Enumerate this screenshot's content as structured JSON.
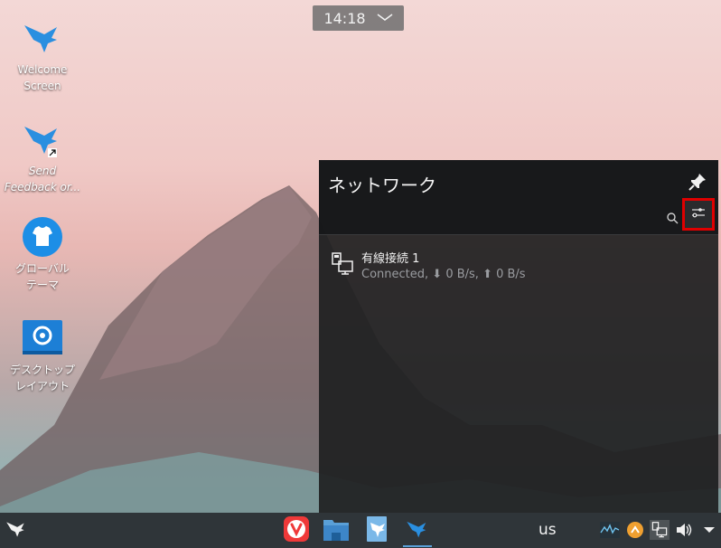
{
  "clock": {
    "time": "14:18",
    "expand_icon": "chevron-down-icon"
  },
  "desktop": {
    "icons": [
      {
        "label_line1": "Welcome",
        "label_line2": "Screen",
        "icon": "bird-logo-icon"
      },
      {
        "label_line1": "Send",
        "label_line2": "Feedback or...",
        "icon": "bird-logo-link-icon"
      },
      {
        "label_line1": "グローバル",
        "label_line2": "テーマ",
        "icon": "shirt-icon"
      },
      {
        "label_line1": "デスクトップ",
        "label_line2": "レイアウト",
        "icon": "desktop-layout-icon"
      }
    ]
  },
  "network_panel": {
    "title": "ネットワーク",
    "pin_icon": "pin-icon",
    "search_icon": "search-icon",
    "settings_icon": "settings-sliders-icon",
    "connection": {
      "name": "有線接続 1",
      "status_prefix": "Connected, ",
      "down": "0 B/s",
      "separator": ", ",
      "up": "0 B/s",
      "icon": "wired-network-icon"
    }
  },
  "taskbar": {
    "launcher_icon": "bird-logo-icon",
    "apps": [
      {
        "name": "vivaldi-icon"
      },
      {
        "name": "file-manager-icon"
      },
      {
        "name": "document-viewer-icon"
      },
      {
        "name": "bird-app-icon"
      }
    ],
    "keyboard_layout": "us",
    "tray": [
      {
        "name": "system-monitor-icon"
      },
      {
        "name": "updates-icon"
      },
      {
        "name": "network-tray-icon"
      },
      {
        "name": "volume-icon"
      },
      {
        "name": "tray-expand-icon"
      }
    ]
  },
  "colors": {
    "highlight": "#e00000",
    "accent": "#5aa0d8",
    "panel_bg": "#1e1f21"
  }
}
